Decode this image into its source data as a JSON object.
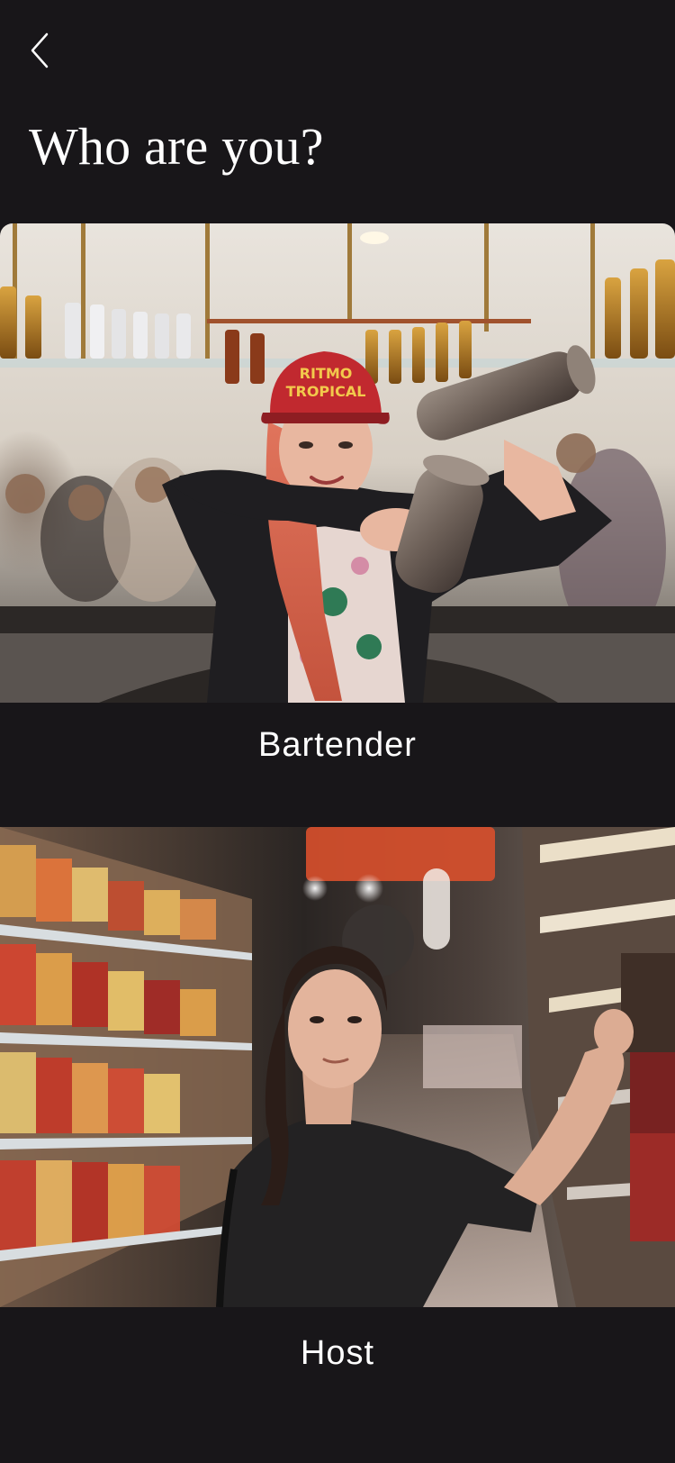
{
  "nav": {
    "back_icon": "chevron-left-icon"
  },
  "page": {
    "title": "Who are you?"
  },
  "roles": [
    {
      "label": "Bartender",
      "image": "bartender-photo",
      "cap_text_line1": "RITMO",
      "cap_text_line2": "TROPICAL"
    },
    {
      "label": "Host",
      "image": "host-photo"
    }
  ],
  "colors": {
    "background": "#181619",
    "text": "#ffffff"
  }
}
